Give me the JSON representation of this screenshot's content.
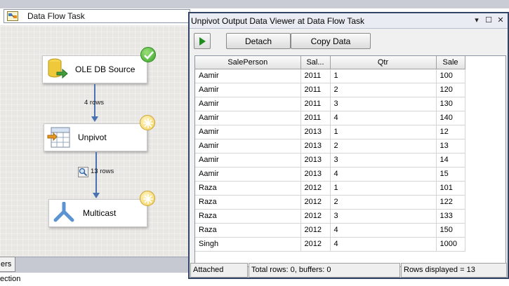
{
  "designer": {
    "task_combo": {
      "label": "Data Flow Task"
    },
    "components": [
      {
        "label": "OLE DB Source",
        "status": "success"
      },
      {
        "label": "Unpivot",
        "status": "waiting"
      },
      {
        "label": "Multicast",
        "status": "waiting"
      }
    ],
    "paths": [
      {
        "label": "4 rows"
      },
      {
        "label": "13 rows"
      }
    ],
    "bottom_tab": {
      "label": "ers"
    },
    "bottom_text": "ection"
  },
  "viewer": {
    "title": "Unpivot Output Data Viewer at Data Flow Task",
    "window_buttons": {
      "pin": "▾",
      "restore": "☐",
      "close": "✕"
    },
    "toolbar": {
      "detach_label": "Detach",
      "copy_label": "Copy Data"
    },
    "columns": [
      "SalePerson",
      "Sal...",
      "Qtr",
      "Sale"
    ],
    "rows": [
      [
        "Aamir",
        "2011",
        "1",
        "100"
      ],
      [
        "Aamir",
        "2011",
        "2",
        "120"
      ],
      [
        "Aamir",
        "2011",
        "3",
        "130"
      ],
      [
        "Aamir",
        "2011",
        "4",
        "140"
      ],
      [
        "Aamir",
        "2013",
        "1",
        "12"
      ],
      [
        "Aamir",
        "2013",
        "2",
        "13"
      ],
      [
        "Aamir",
        "2013",
        "3",
        "14"
      ],
      [
        "Aamir",
        "2013",
        "4",
        "15"
      ],
      [
        "Raza",
        "2012",
        "1",
        "101"
      ],
      [
        "Raza",
        "2012",
        "2",
        "122"
      ],
      [
        "Raza",
        "2012",
        "3",
        "133"
      ],
      [
        "Raza",
        "2012",
        "4",
        "150"
      ],
      [
        "Singh",
        "2012",
        "4",
        "1000"
      ]
    ],
    "status": {
      "attached": "Attached",
      "totals": "Total rows: 0, buffers: 0",
      "displayed": "Rows displayed = 13"
    }
  },
  "colors": {
    "accent": "#324566",
    "flow_line": "#4a72b0",
    "play_green": "#1e8c1e"
  }
}
